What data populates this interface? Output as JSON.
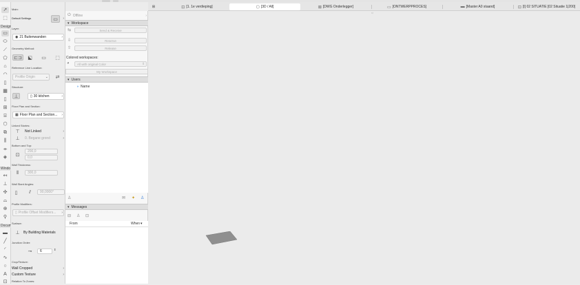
{
  "toolbox": {
    "sections": [
      {
        "label": "Design"
      },
      {
        "label": "Windo"
      },
      {
        "label": "Docum"
      }
    ],
    "tools": [
      "arrow-select-icon",
      "marquee-icon",
      "wall-icon",
      "column-icon",
      "beam-icon",
      "slab-icon",
      "roof-icon",
      "shell-icon",
      "skylight-icon",
      "curtain-wall-icon",
      "door-icon",
      "window-icon",
      "object-icon",
      "zone-icon",
      "stair-icon",
      "railing-icon",
      "mesh-icon",
      "morph-icon",
      "opening-icon",
      "lamp-icon",
      "dimension-icon",
      "level-icon",
      "text-icon",
      "label-icon",
      "fill-icon",
      "line-icon",
      "arc-icon",
      "polyline-icon",
      "spline-icon",
      "circle-icon",
      "hotspot-icon",
      "figure-icon"
    ]
  },
  "infobox": {
    "main_label": "Main:",
    "default_settings_label": "Default Settings",
    "layer_label": "Layer:",
    "layer_value": "21 Buitenwanden",
    "geometry_label": "Geometry Method:",
    "reference_line_label": "Reference Line Location:",
    "reference_line_value": "Profile Origin",
    "structure_label": "Structure:",
    "structure_value": "30 kitchen",
    "floor_plan_label": "Floor Plan and Section:",
    "floor_plan_value": "Floor Plan and Section...",
    "linked_stories_label": "Linked Stories:",
    "linked_top": "Not Linked",
    "linked_bottom": "0. Begane grond",
    "bottom_top_label": "Bottom and Top:",
    "top_value": "200,0",
    "bottom_value": "0,0",
    "wall_thickness_label": "Wall Thickness:",
    "wall_thickness_value": "300,0",
    "wall_slant_label": "Wall Slant Angles:",
    "wall_slant_value": "90,0000°",
    "profile_modifiers_label": "Profile Modifiers:",
    "profile_modifiers_value": "Profile Offset Modifiers...",
    "surface_label": "Surface:",
    "surface_value": "By Building Materials",
    "junction_order_label": "Junction Order:",
    "junction_order_value": "6",
    "crop_texture_label": "Crop/Texture:",
    "wall_cropped": "Wall Cropped",
    "custom_texture": "Custom Texture",
    "relation_zones_label": "Relation To Zones:"
  },
  "teamwork": {
    "status": "Offline",
    "workspace_section": "Workspace",
    "send_receive": "Send & Receive",
    "reserve": "Reserve",
    "release": "Release",
    "colored_workspaces_label": "Colored workspaces:",
    "colored_select": "All with original Color",
    "my_workspace": "My Workspace",
    "users_section": "Users",
    "user_name": "Name",
    "messages_section": "Messages",
    "col_from": "From",
    "col_when": "When"
  },
  "tabs": [
    {
      "icon": "floor-plan-icon",
      "label": "[1. 1e verdieping]",
      "active": false
    },
    {
      "icon": "3d-window-icon",
      "label": "[3D / All]",
      "active": true
    },
    {
      "icon": "worksheet-icon",
      "label": "[DWG Onderlegger]",
      "active": false
    },
    {
      "icon": "layout-icon",
      "label": "[ONTWERPPROCES]",
      "active": false
    },
    {
      "icon": "master-layout-icon",
      "label": "[Master A0 staand]",
      "active": false
    },
    {
      "icon": "drawing-icon",
      "label": "[I] 02 SITUATIE [02 Situatie 1|200]",
      "active": false
    }
  ],
  "colors": {
    "toolbox_bg": "#f3f3f3",
    "panel_bg": "#ececec",
    "canvas_bg": "#ebebeb",
    "slab_fill": "#8f8f8f"
  }
}
